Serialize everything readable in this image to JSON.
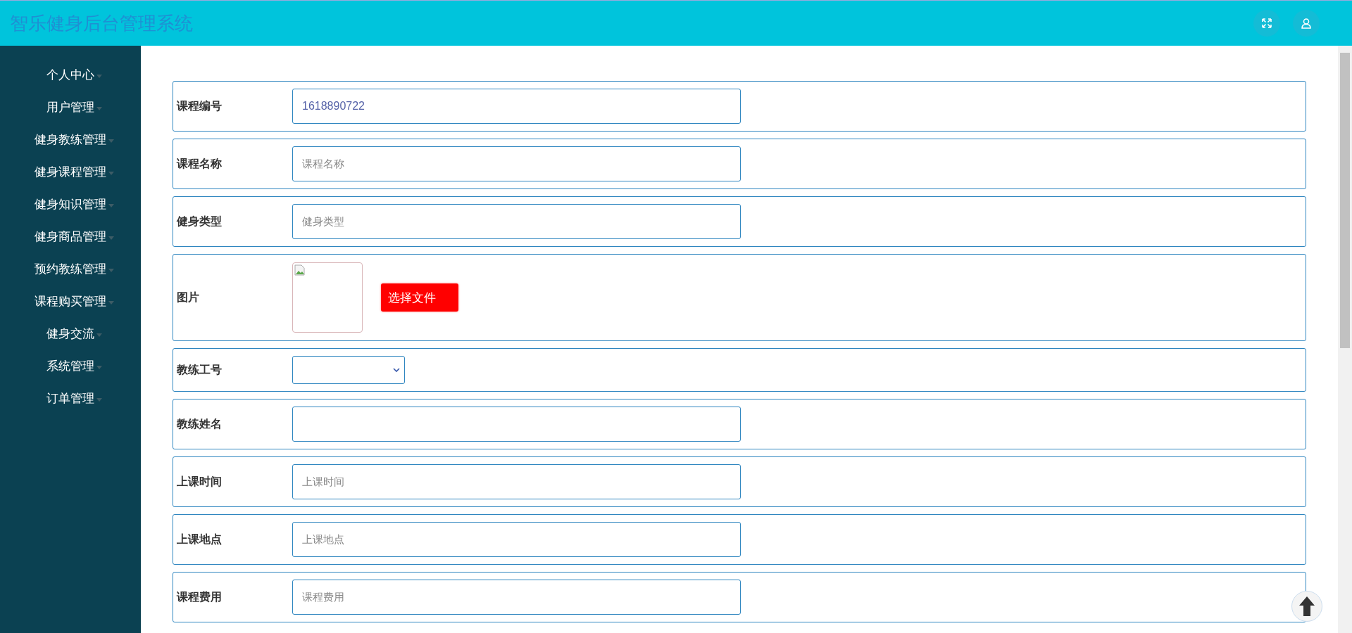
{
  "header": {
    "title": "智乐健身后台管理系统"
  },
  "sidebar": {
    "items": [
      {
        "label": "个人中心"
      },
      {
        "label": "用户管理"
      },
      {
        "label": "健身教练管理"
      },
      {
        "label": "健身课程管理"
      },
      {
        "label": "健身知识管理"
      },
      {
        "label": "健身商品管理"
      },
      {
        "label": "预约教练管理"
      },
      {
        "label": "课程购买管理"
      },
      {
        "label": "健身交流"
      },
      {
        "label": "系统管理"
      },
      {
        "label": "订单管理"
      }
    ]
  },
  "form": {
    "fields": [
      {
        "kind": "input",
        "label": "课程编号",
        "value": "1618890722"
      },
      {
        "kind": "input",
        "label": "课程名称",
        "placeholder": "课程名称"
      },
      {
        "kind": "input",
        "label": "健身类型",
        "placeholder": "健身类型"
      },
      {
        "kind": "image",
        "label": "图片",
        "button": "选择文件"
      },
      {
        "kind": "select",
        "label": "教练工号"
      },
      {
        "kind": "input",
        "label": "教练姓名"
      },
      {
        "kind": "input",
        "label": "上课时间",
        "placeholder": "上课时间"
      },
      {
        "kind": "input",
        "label": "上课地点",
        "placeholder": "上课地点"
      },
      {
        "kind": "input",
        "label": "课程费用",
        "placeholder": "课程费用"
      }
    ]
  }
}
